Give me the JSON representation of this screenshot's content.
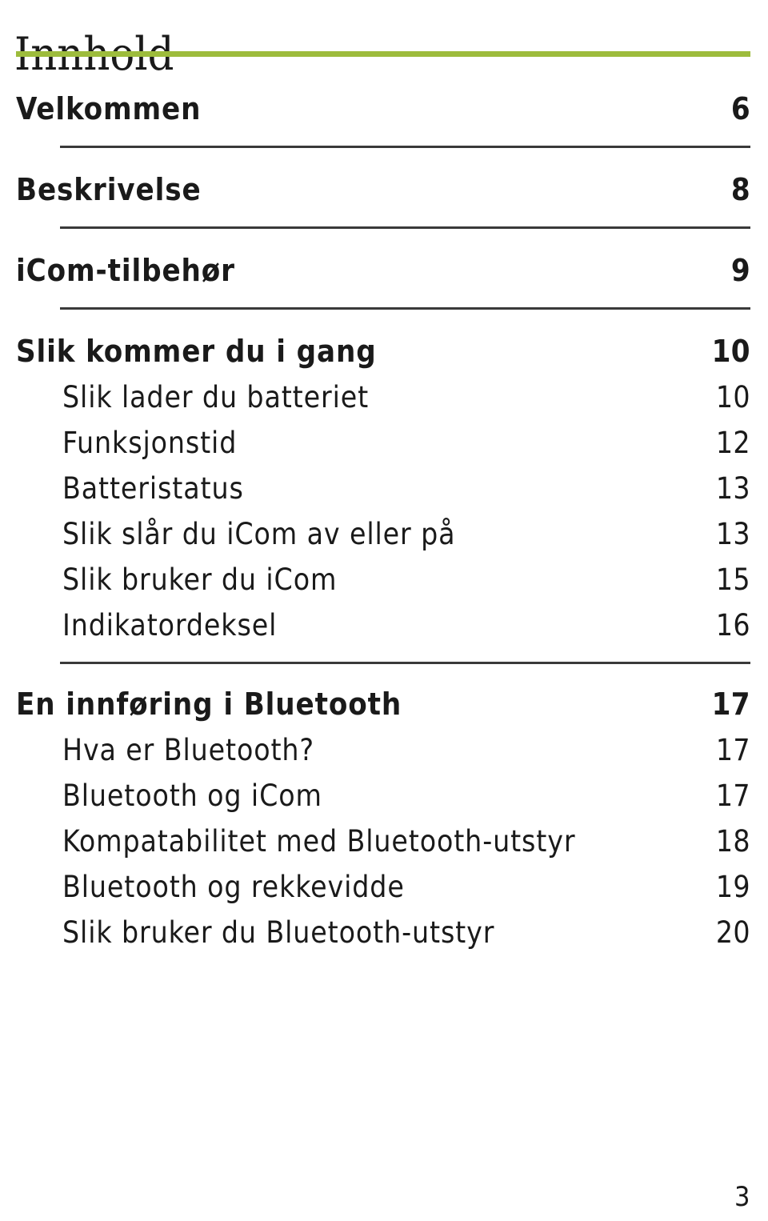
{
  "document": {
    "title": "Innhold",
    "accent_color": "#9dbc3c",
    "text_color": "#1a1a1a",
    "rule_color": "#3a3a3a",
    "folio": "3"
  },
  "toc": {
    "groups": [
      {
        "rule_after": true,
        "entries": [
          {
            "level": 1,
            "label": "Velkommen",
            "page": "6"
          }
        ]
      },
      {
        "rule_after": true,
        "entries": [
          {
            "level": 1,
            "label": "Beskrivelse",
            "page": "8"
          }
        ]
      },
      {
        "rule_after": true,
        "entries": [
          {
            "level": 1,
            "label": "iCom-tilbehør",
            "page": "9"
          }
        ]
      },
      {
        "rule_after": true,
        "entries": [
          {
            "level": 1,
            "label": "Slik kommer du i gang",
            "page": "10"
          },
          {
            "level": 2,
            "label": "Slik lader du batteriet",
            "page": "10"
          },
          {
            "level": 2,
            "label": "Funksjonstid",
            "page": "12"
          },
          {
            "level": 2,
            "label": "Batteristatus",
            "page": "13"
          },
          {
            "level": 2,
            "label": "Slik slår du iCom av eller på",
            "page": "13"
          },
          {
            "level": 2,
            "label": "Slik bruker du iCom",
            "page": "15"
          },
          {
            "level": 2,
            "label": "Indikatordeksel",
            "page": "16"
          }
        ]
      },
      {
        "rule_after": false,
        "entries": [
          {
            "level": 1,
            "label": "En innføring i Bluetooth",
            "page": "17"
          },
          {
            "level": 2,
            "label": "Hva er Bluetooth?",
            "page": "17"
          },
          {
            "level": 2,
            "label": "Bluetooth og iCom",
            "page": "17"
          },
          {
            "level": 2,
            "label": "Kompatabilitet med Bluetooth-utstyr",
            "page": "18"
          },
          {
            "level": 2,
            "label": "Bluetooth og rekkevidde",
            "page": "19"
          },
          {
            "level": 2,
            "label": "Slik bruker du Bluetooth-utstyr",
            "page": "20"
          }
        ]
      }
    ]
  }
}
